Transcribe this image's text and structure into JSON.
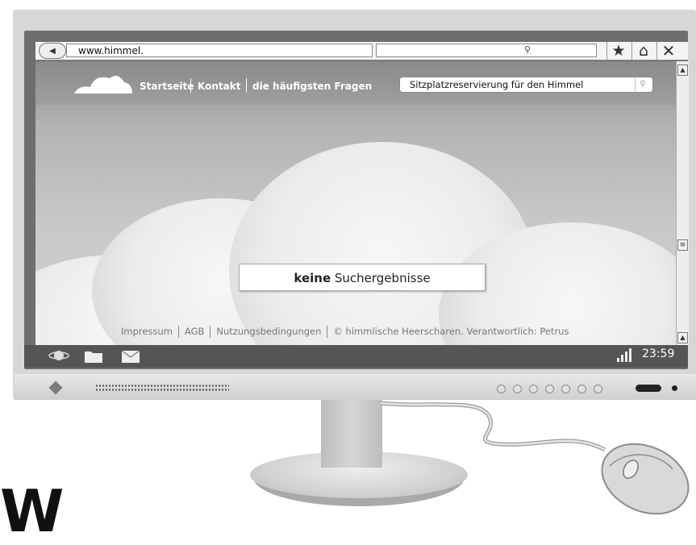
{
  "browser": {
    "url": "www.himmel.",
    "search_value": "",
    "search_icon": "search-icon",
    "toolbar_icons": [
      "star-icon",
      "home-icon",
      "close-icon"
    ]
  },
  "site": {
    "nav": [
      "Startseite",
      "Kontakt",
      "die häufigsten Fragen"
    ],
    "search_value": "Sitzplatzreservierung für den Himmel",
    "result_bold": "keine",
    "result_rest": " Suchergebnisse",
    "footer": [
      "Impressum",
      "AGB",
      "Nutzungsbedingungen",
      "© himmlische Heerscharen. Verantwortlich: Petrus"
    ]
  },
  "taskbar": {
    "clock": "23:59",
    "icons": [
      "planet-icon",
      "folder-icon",
      "mail-icon",
      "signal-icon"
    ]
  },
  "decor": {
    "corner_text": "",
    "brand_letter": "W"
  }
}
